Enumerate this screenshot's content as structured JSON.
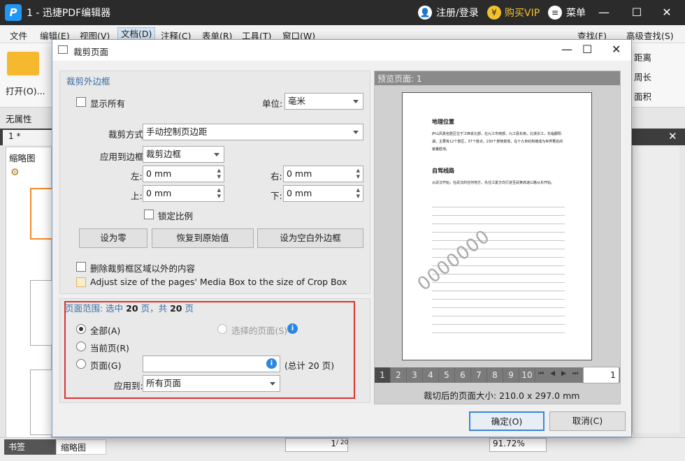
{
  "app": {
    "title": "1 - 迅捷PDF编辑器",
    "login": "注册/登录",
    "vip": "购买VIP",
    "menu_label": "菜单"
  },
  "menubar": [
    "文件",
    "编辑(E)",
    "视图(V)",
    "文档(D)",
    "注释(C)",
    "表单(R)",
    "工具(T)",
    "窗口(W)"
  ],
  "toolbar_right": {
    "find": "查找(F)",
    "advanced_find": "高级查找(S)"
  },
  "ribbon": {
    "open": "打开(O)...",
    "no_attr": "无属性",
    "tab": "1 *",
    "distance": "距离",
    "perimeter": "周长",
    "area": "面积"
  },
  "sidebar": {
    "thumbs_title": "缩略图",
    "bottom_tab_bookmark": "书签",
    "bottom_tab_thumb": "缩略图"
  },
  "statusbar": {
    "page_current": "1",
    "page_total": "/ 20",
    "zoom": "91.72%"
  },
  "dialog": {
    "title": "裁剪页面",
    "margins_group": "裁剪外边框",
    "show_all": "显示所有",
    "unit_label": "单位:",
    "unit_value": "毫米",
    "crop_mode_label": "裁剪方式",
    "crop_mode_value": "手动控制页边距",
    "apply_to_box_label": "应用到边框",
    "apply_to_box_value": "裁剪边框",
    "left_label": "左:",
    "left_value": "0 mm",
    "right_label": "右:",
    "right_value": "0 mm",
    "top_label": "上:",
    "top_value": "0 mm",
    "bottom_label": "下:",
    "bottom_value": "0 mm",
    "lock_ratio": "锁定比例",
    "btn_zero": "设为零",
    "btn_reset": "恢复到原始值",
    "btn_blank": "设为空白外边框",
    "delete_outside": "删除裁剪框区域以外的内容",
    "adjust_media": "Adjust size of the pages' Media Box to the size of Crop Box",
    "range_prefix": "页面范围: 选中",
    "range_count": "20",
    "range_mid": "页，共",
    "range_total": "20",
    "range_suffix": "页",
    "radio_all": "全部(A)",
    "radio_selected": "选择的页面(S)",
    "radio_current": "当前页(R)",
    "radio_pages": "页面(G)",
    "pages_total": "(总计 20 页)",
    "apply_to_label": "应用到:",
    "apply_to_value": "所有页面",
    "preview_label": "预览页面: 1",
    "page_nums": [
      "1",
      "2",
      "3",
      "4",
      "5",
      "6",
      "7",
      "8",
      "9",
      "10"
    ],
    "page_input": "1",
    "cropped_size": "裁切后的页面大小: 210.0 x 297.0 mm",
    "ok": "确定(O)",
    "cancel": "取消(C)"
  },
  "preview_doc": {
    "heading1": "地理位置",
    "para1": "庐山风景名胜区位于江西省北部，在九江市南部，九江县东南，北濒长江，东临鄱阳湖，主要有12个景区，37个景点，230个景物景观，在十九世纪和被成为世界著名的避暑胜地。",
    "heading2": "自驾线路",
    "para2": "从武汉开始，在武汉的任何地方，先往江夏方向行进至武黄高速公路从东开始。",
    "watermark": "0000000"
  }
}
